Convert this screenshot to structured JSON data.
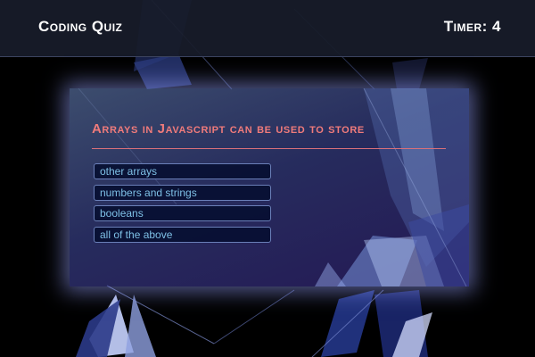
{
  "header": {
    "title": "Coding Quiz",
    "timer_label": "Timer: 4"
  },
  "quiz": {
    "question": "Arrays in Javascript can be used to store",
    "answers": [
      "other arrays",
      "numbers and strings",
      "booleans",
      "all of the above"
    ]
  },
  "colors": {
    "question_text": "#f07b7b",
    "answer_text": "#7ec0e6",
    "header_bg": "#181c2a"
  }
}
